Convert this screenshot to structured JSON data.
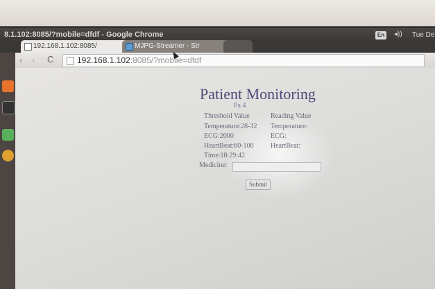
{
  "window": {
    "title": "8.1.102:8085/?mobile=dfdf - Google Chrome"
  },
  "tabs": [
    {
      "label": "192.168.1.102:8085/",
      "close": "×"
    },
    {
      "label": "MJPG-Streamer - Str",
      "close": "×"
    }
  ],
  "tray": {
    "lang": "En",
    "volume": "◂))",
    "clock": "Tue De"
  },
  "toolbar": {
    "back": "‹",
    "forward": "›",
    "reload": "C",
    "url_host": "192.168.1.102",
    "url_rest": ":8085/?mobile=dfdf"
  },
  "page": {
    "heading": "Patient   Monitoring",
    "subheading": "Pa                  4",
    "col_headers": [
      "Threshold Value",
      "Reading Value"
    ],
    "rows": [
      {
        "threshold": "Temperature:28-32",
        "reading": "Temperature:"
      },
      {
        "threshold": "ECG:2000",
        "reading": "ECG:"
      },
      {
        "threshold": "HeartBeat:60-100",
        "reading": "HeartBeat:"
      }
    ],
    "time": "Time:18:29:42",
    "medicine_label": "Medicine:",
    "medicine_value": "",
    "submit_label": "Submit"
  },
  "colors": {
    "heading": "#4a4a78",
    "titlebar": "#393634",
    "launcher": "#4c4542"
  }
}
